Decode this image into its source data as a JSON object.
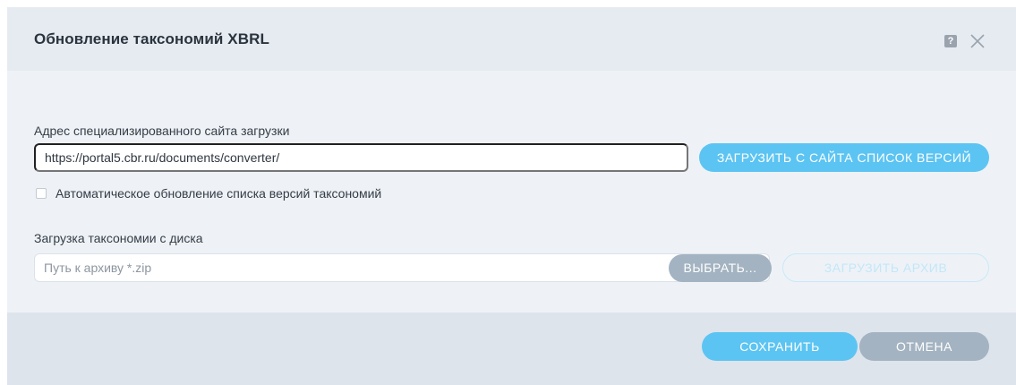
{
  "dialog": {
    "title": "Обновление таксономий XBRL",
    "help_glyph": "?",
    "icons": [
      "help-icon",
      "close-icon"
    ]
  },
  "site": {
    "label": "Адрес специализированного сайта загрузки",
    "url_value": "https://portal5.cbr.ru/documents/converter/",
    "load_list_button": "ЗАГРУЗИТЬ С САЙТА СПИСОК ВЕРСИЙ"
  },
  "auto_update": {
    "label": "Автоматическое обновление списка версий таксономий",
    "checked": false
  },
  "disk": {
    "label": "Загрузка таксономии с диска",
    "path_placeholder": "Путь к архиву *.zip",
    "choose_button": "ВЫБРАТЬ...",
    "upload_button": "ЗАГРУЗИТЬ АРХИВ"
  },
  "footer": {
    "save_button": "СОХРАНИТЬ",
    "cancel_button": "ОТМЕНА"
  },
  "colors": {
    "accent": "#5cc4f2",
    "secondary_button": "#a3b3c1",
    "header_bg": "#e5ebf1",
    "body_bg": "#eef2f6",
    "footer_bg": "#dde4eb"
  }
}
